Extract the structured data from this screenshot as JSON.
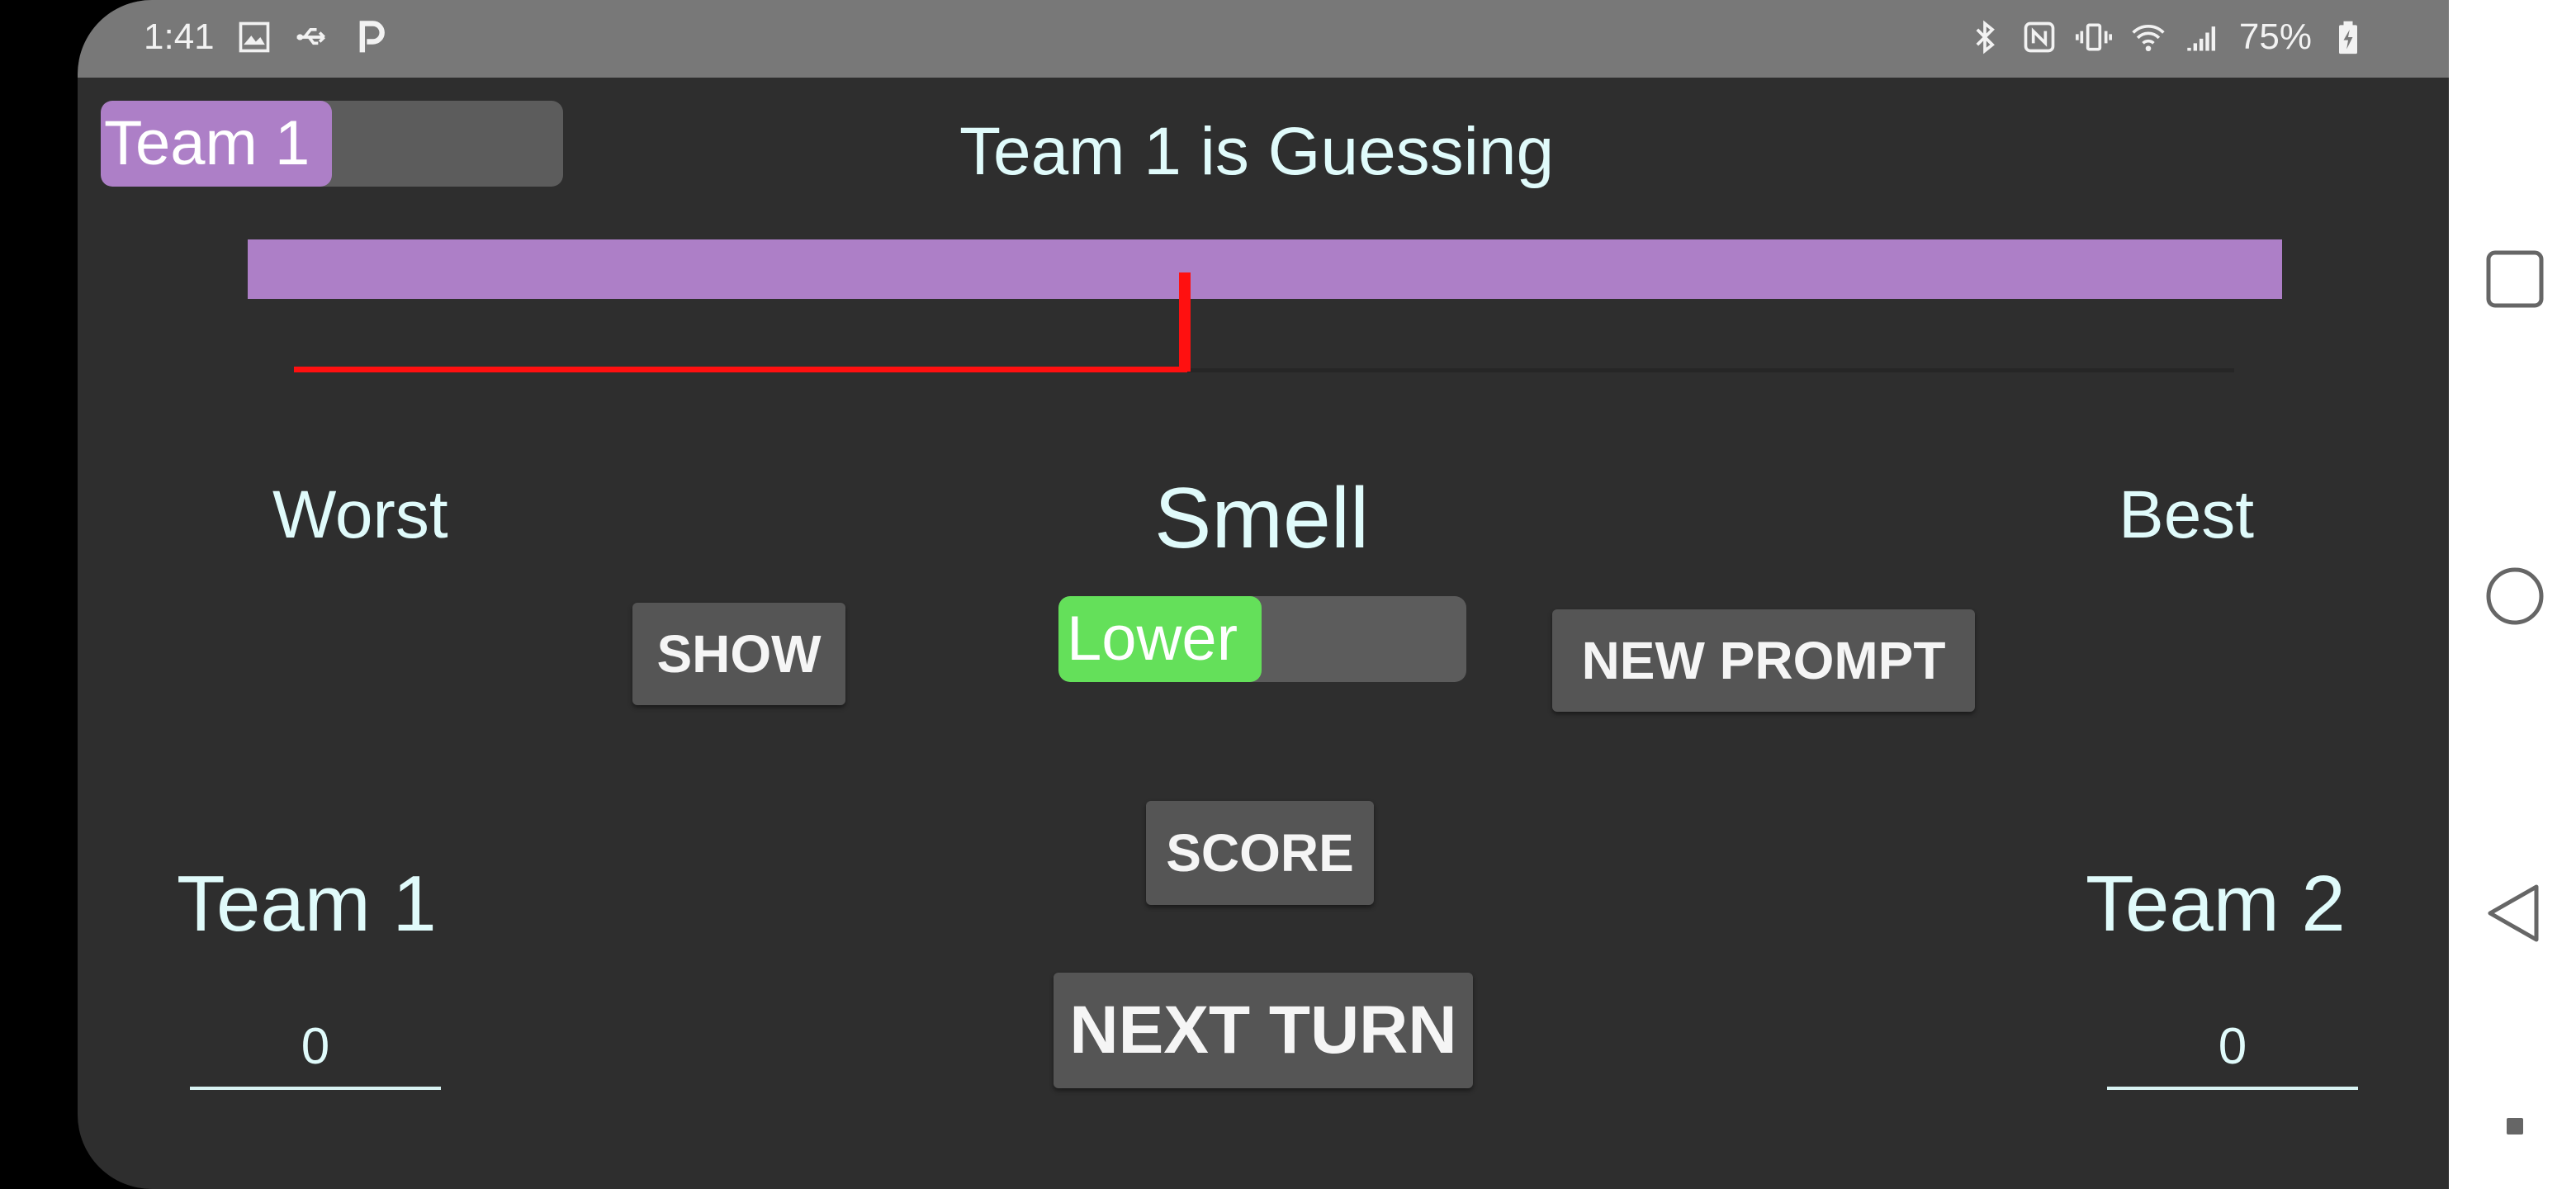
{
  "status_bar": {
    "time": "1:41",
    "left_icons": [
      "image-icon",
      "usb-icon",
      "p-app-icon"
    ],
    "right_icons": [
      "bluetooth-icon",
      "nfc-icon",
      "vibrate-icon",
      "wifi-icon",
      "signal-icon"
    ],
    "battery": "75%"
  },
  "header": {
    "team_toggle_label": "Team 1",
    "team_toggle_level": 0.5,
    "guessing_text": "Team 1 is Guessing"
  },
  "spectrum": {
    "bar_color": "#ad7fc7",
    "line_color": "#ff1010",
    "marker_fraction": 0.46
  },
  "prompt": {
    "left_label": "Worst",
    "center_label": "Smell",
    "right_label": "Best"
  },
  "controls": {
    "show_button": "SHOW",
    "lower_toggle_label": "Lower",
    "lower_toggle_level": 0.5,
    "lower_color": "#64e05a",
    "new_prompt_button": "NEW PROMPT",
    "score_button": "SCORE",
    "next_turn_button": "NEXT TURN"
  },
  "scores": {
    "team1_label": "Team 1",
    "team1_value": "0",
    "team2_label": "Team 2",
    "team2_value": "0"
  },
  "colors": {
    "team_color": "#ad7fc7",
    "background": "#2e2e2e",
    "text": "#e0fbfb"
  }
}
